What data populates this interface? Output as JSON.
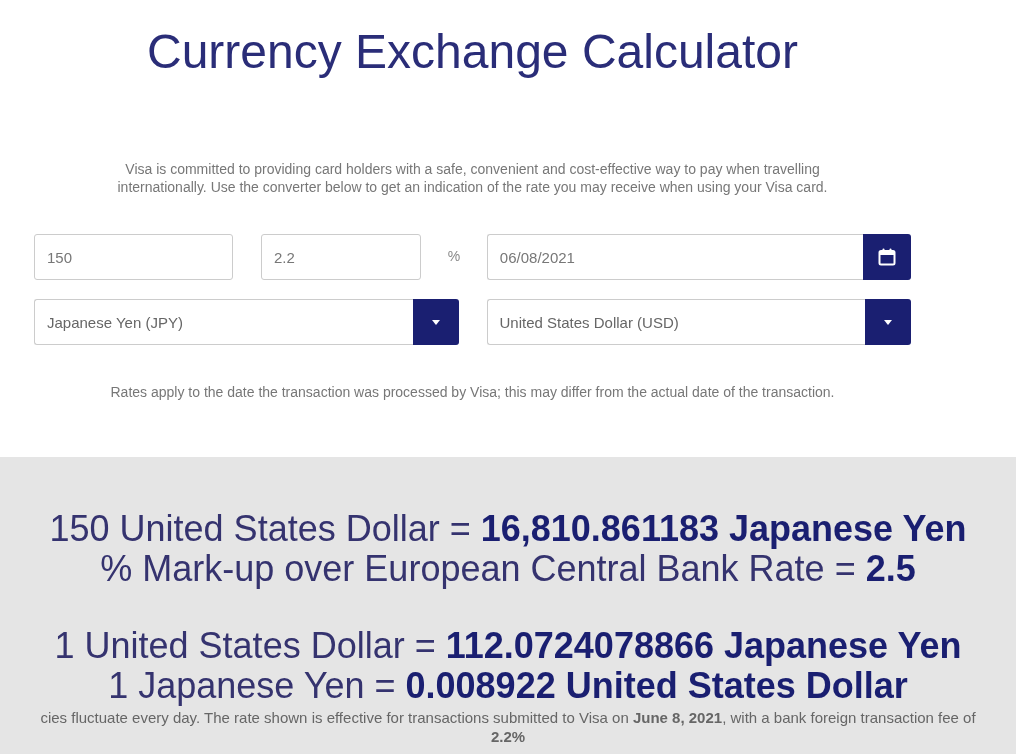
{
  "title": "Currency Exchange Calculator",
  "intro": "Visa is committed to providing card holders with a safe, convenient and cost-effective way to pay when travelling internationally. Use the converter below to get an indication of the rate you may receive when using your Visa card.",
  "form": {
    "amount": {
      "value": "150"
    },
    "fee": {
      "value": "2.2",
      "suffix": "%"
    },
    "date": {
      "value": "06/08/2021"
    },
    "from_currency": {
      "value": "Japanese Yen (JPY)"
    },
    "to_currency": {
      "value": "United States Dollar (USD)"
    }
  },
  "note": "Rates apply to the date the transaction was processed by Visa; this may differ from the actual date of the transaction.",
  "results": {
    "groups": [
      {
        "lines": [
          "150 United States Dollar = **16,810.861183 Japanese Yen**",
          "% Mark-up over European Central Bank Rate = **2.5**"
        ]
      },
      {
        "lines": [
          "1 United States Dollar = **112.0724078866 Japanese Yen**",
          "1 Japanese Yen = **0.008922 United States Dollar**"
        ]
      }
    ],
    "footnote": "cies fluctuate every day. The rate shown is effective for transactions submitted to Visa on **June 8, 2021**, with a bank foreign transaction fee of **2.2%**"
  }
}
